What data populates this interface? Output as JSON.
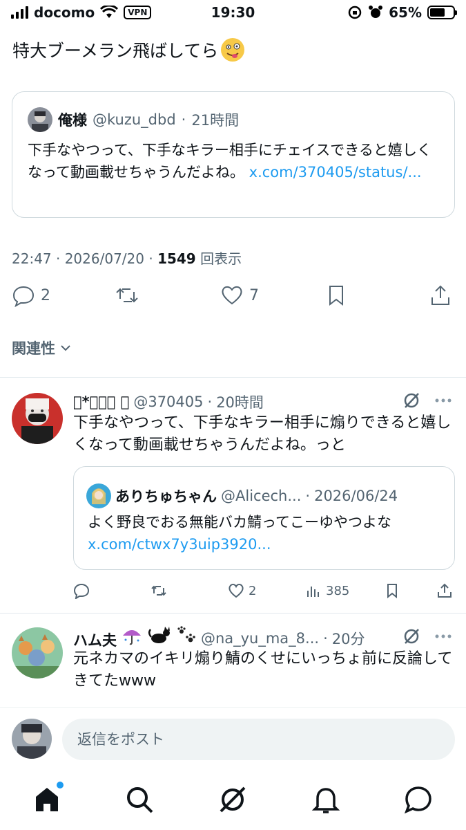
{
  "status_bar": {
    "carrier": "docomo",
    "vpn": "VPN",
    "time": "19:30",
    "battery": "65%",
    "battery_level": 0.65
  },
  "tweet": {
    "text": "特大ブーメラン飛ばしてら"
  },
  "quoted_tweet": {
    "name": "俺様",
    "handle": "@kuzu_dbd",
    "sep": "·",
    "time": "21時間",
    "text": "下手なやつって、下手なキラー相手にチェイスできると嬉しくなって動画載せちゃうんだよね。",
    "link": "x.com/370405/status/..."
  },
  "meta": {
    "time_date": "22:47 · 2026/07/20 · ",
    "views_count": "1549",
    "views_label": "回表示"
  },
  "actions": {
    "replies": "2",
    "likes": "7"
  },
  "related_label": "関連性",
  "replies": [
    {
      "name": "*𝑦𝑢𝑢",
      "handle": "@370405",
      "sep": "·",
      "time": "20時間",
      "text": "下手なやつって、下手なキラー相手に煽りできると嬉しくなって動画載せちゃうんだよね。っと",
      "quote": {
        "name": "ありちゅちゃん",
        "handle": "@Alicech...",
        "sep": "·",
        "date": "2026/06/24",
        "text": "よく野良でおる無能バカ鯖ってこーゆやつよな",
        "link": "x.com/ctwx7y3uip3920..."
      },
      "likes": "2",
      "views": "385"
    },
    {
      "name": "ハム夫",
      "handle": "@na_yu_ma_8...",
      "sep": "·",
      "time": "20分",
      "text": "元ネカマのイキリ煽り鯖のくせにいっちょ前に反論してきてたwww"
    }
  ],
  "composer": {
    "placeholder": "返信をポスト"
  },
  "tabs": [
    "home-icon",
    "search-icon",
    "grok-icon",
    "notifications-icon",
    "messages-icon"
  ]
}
